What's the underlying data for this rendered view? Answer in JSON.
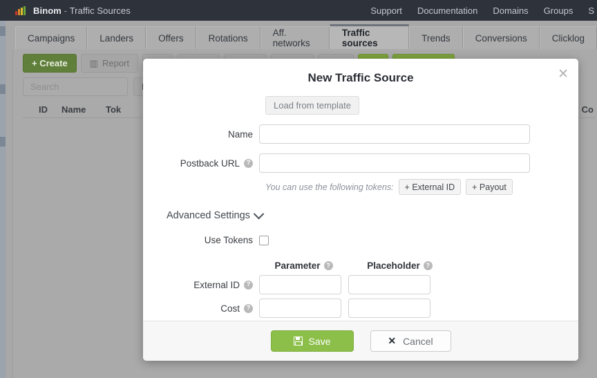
{
  "topbar": {
    "brand": "Binom",
    "separator": "-",
    "section": "Traffic Sources",
    "logo_icon": "bar-chart-logo-icon",
    "links": [
      {
        "label": "Support"
      },
      {
        "label": "Documentation"
      },
      {
        "label": "Domains"
      },
      {
        "label": "Groups"
      },
      {
        "label": "S"
      }
    ]
  },
  "tabs": [
    {
      "label": "Campaigns",
      "active": false
    },
    {
      "label": "Landers",
      "active": false
    },
    {
      "label": "Offers",
      "active": false
    },
    {
      "label": "Rotations",
      "active": false
    },
    {
      "label": "Aff. networks",
      "active": false
    },
    {
      "label": "Traffic sources",
      "active": true
    },
    {
      "label": "Trends",
      "active": false
    },
    {
      "label": "Conversions",
      "active": false
    },
    {
      "label": "Clicklog",
      "active": false
    }
  ],
  "toolbar": {
    "create_label": "+ Create",
    "report_label": "Report",
    "report_icon": "bar-chart-icon",
    "edit_icon": "pencil-icon",
    "clone_icon": "copy-icon",
    "archive_icon": "archive-icon",
    "link_icon": "link-icon",
    "more_icon": "ellipsis-icon",
    "green1_icon": "refresh-icon",
    "green2_icon": "play-icon"
  },
  "search": {
    "placeholder": "Search",
    "value": "",
    "delete_label": "Delete"
  },
  "table": {
    "columns": [
      {
        "label": "ID"
      },
      {
        "label": "Name"
      },
      {
        "label": "Tok"
      },
      {
        "label": "Co"
      }
    ]
  },
  "modal": {
    "title": "New Traffic Source",
    "close_icon": "close-icon",
    "template_button": "Load from template",
    "fields": {
      "name_label": "Name",
      "name_value": "",
      "postback_label": "Postback URL",
      "postback_value": "",
      "postback_help_icon": "question-icon"
    },
    "tokens_hint": "You can use the following tokens:",
    "token_buttons": [
      {
        "label": "+ External ID"
      },
      {
        "label": "+ Payout"
      }
    ],
    "advanced": {
      "label": "Advanced Settings",
      "chevron_icon": "chevron-down-icon"
    },
    "use_tokens": {
      "label": "Use Tokens",
      "checked": false
    },
    "param_table": {
      "headers": [
        {
          "label": "Parameter",
          "help_icon": "question-icon"
        },
        {
          "label": "Placeholder",
          "help_icon": "question-icon"
        }
      ],
      "rows": [
        {
          "label": "External ID",
          "help_icon": "question-icon",
          "parameter": "",
          "placeholder": ""
        },
        {
          "label": "Cost",
          "help_icon": "question-icon",
          "parameter": "",
          "placeholder": ""
        }
      ]
    },
    "footer": {
      "save_label": "Save",
      "save_icon": "floppy-disk-icon",
      "cancel_label": "Cancel",
      "cancel_icon": "close-x-icon"
    }
  },
  "colors": {
    "topbar_bg": "#2e323b",
    "save_green": "#8cbf49",
    "create_green": "#5f7f3a",
    "page_bg": "#a8a8a8"
  },
  "help_glyph": "?"
}
